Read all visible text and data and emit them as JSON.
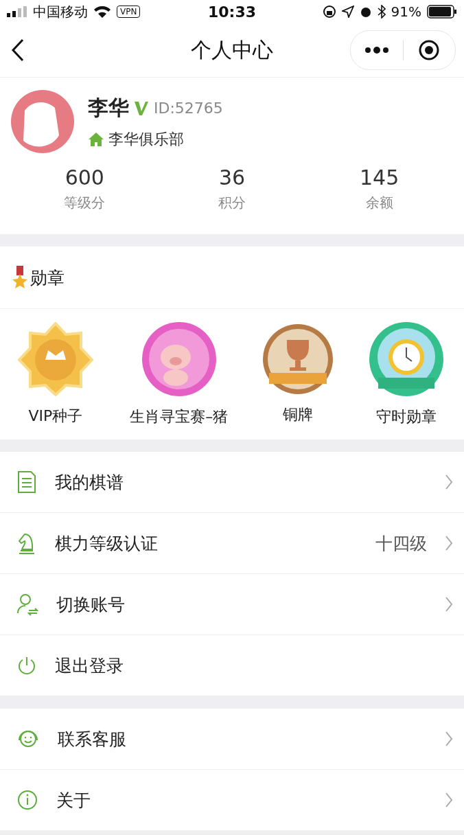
{
  "status_bar": {
    "carrier": "中国移动",
    "vpn": "VPN",
    "time": "10:33",
    "battery": "91%"
  },
  "nav": {
    "title": "个人中心"
  },
  "profile": {
    "name": "李华",
    "id": "ID:52765",
    "club": "李华俱乐部",
    "verified": true,
    "stats": [
      {
        "value": "600",
        "label": "等级分"
      },
      {
        "value": "36",
        "label": "积分"
      },
      {
        "value": "145",
        "label": "余额"
      }
    ]
  },
  "medals": {
    "title": "勋章",
    "items": [
      {
        "kind": "vip",
        "label": "VIP种子"
      },
      {
        "kind": "pig",
        "label": "生肖寻宝赛–猪"
      },
      {
        "kind": "bronze",
        "label": "铜牌"
      },
      {
        "kind": "clock",
        "label": "守时勋章"
      }
    ]
  },
  "menu_groups": [
    [
      {
        "label": "我的棋谱",
        "chevron": true
      },
      {
        "label": "棋力等级认证",
        "value": "十四级",
        "chevron": true
      },
      {
        "label": "切换账号",
        "chevron": true
      },
      {
        "label": "退出登录",
        "chevron": false
      }
    ],
    [
      {
        "label": "联系客服",
        "chevron": true
      },
      {
        "label": "关于",
        "chevron": true
      }
    ]
  ]
}
